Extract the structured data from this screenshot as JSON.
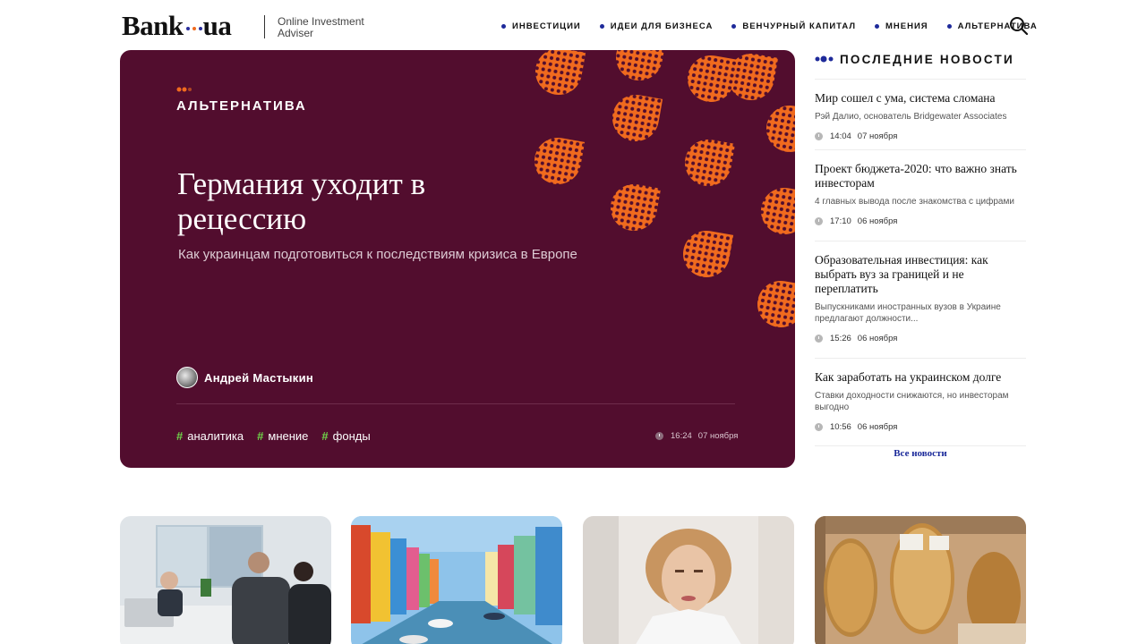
{
  "header": {
    "logo_left": "Bank",
    "logo_right": "ua",
    "tagline_line1": "Online Investment",
    "tagline_line2": "Adviser",
    "nav": [
      "ИНВЕСТИЦИИ",
      "ИДЕИ ДЛЯ БИЗНЕСА",
      "ВЕНЧУРНЫЙ КАПИТАЛ",
      "МНЕНИЯ",
      "АЛЬТЕРНАТИВА"
    ],
    "search_icon": "search-icon"
  },
  "hero": {
    "category": "АЛЬТЕРНАТИВА",
    "title": "Германия уходит в рецессию",
    "subtitle": "Как украинцам подготовиться к последствиям кризиса в Европе",
    "author": "Андрей Мастыкин",
    "tags": [
      "аналитика",
      "мнение",
      "фонды"
    ],
    "tag_prefix": "#",
    "time": "16:24",
    "date": "07 ноября",
    "colors": {
      "background": "#520d2e",
      "accent": "#f06a1e",
      "hash": "#6fd64a"
    }
  },
  "news": {
    "heading": "ПОСЛЕДНИЕ НОВОСТИ",
    "items": [
      {
        "title": "Мир сошел с ума, система сломана",
        "subtitle": "Рэй Далио, основатель Bridgewater Associates",
        "time": "14:04",
        "date": "07 ноября"
      },
      {
        "title": "Проект бюджета-2020: что важно знать инвесторам",
        "subtitle": "4 главных вывода после знакомства с цифрами",
        "time": "17:10",
        "date": "06 ноября"
      },
      {
        "title": "Образовательная инвестиция: как выбрать вуз за границей и не переплатить",
        "subtitle": "Выпускниками иностранных вузов в Украине предлагают должности...",
        "time": "15:26",
        "date": "06 ноября"
      },
      {
        "title": "Как заработать на украинском долге",
        "subtitle": "Ставки доходности снижаются, но инвесторам выгодно",
        "time": "10:56",
        "date": "06 ноября"
      }
    ],
    "all_link": "Все новости"
  },
  "cards": [
    {
      "image": "business-meeting-photo"
    },
    {
      "image": "colorful-canal-houses-photo"
    },
    {
      "image": "woman-portrait-photo"
    },
    {
      "image": "nut-bags-shop-photo"
    }
  ]
}
